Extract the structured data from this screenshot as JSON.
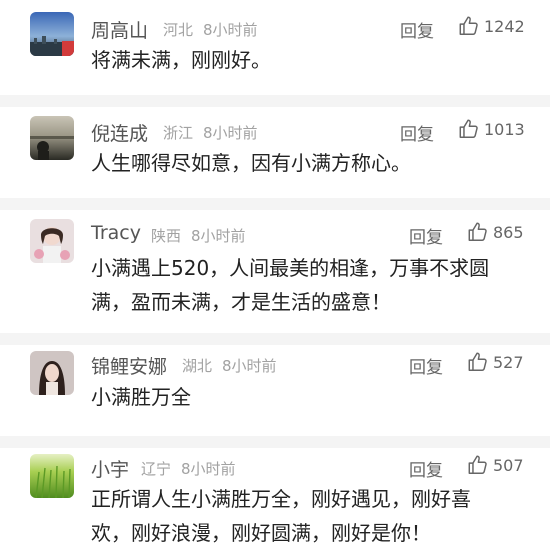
{
  "comments": [
    {
      "username": "周高山",
      "location": "河北",
      "time": "8小时前",
      "reply_label": "回复",
      "likes": "1242",
      "lines": [
        "将满未满，刚刚好。"
      ],
      "avatar": "sky-city-avatar"
    },
    {
      "username": "倪连成",
      "location": "浙江",
      "time": "8小时前",
      "reply_label": "回复",
      "likes": "1013",
      "lines": [
        "人生哪得尽如意，因有小满方称心。"
      ],
      "avatar": "lake-sunset-avatar"
    },
    {
      "username": "Tracy",
      "location": "陕西",
      "time": "8小时前",
      "reply_label": "回复",
      "likes": "865",
      "lines": [
        "小满遇上520，人间最美的相逢，万事不求圆",
        "满，盈而未满，才是生活的盛意！"
      ],
      "avatar": "girl-flowers-avatar"
    },
    {
      "username": "锦鲤安娜",
      "location": "湖北",
      "time": "8小时前",
      "reply_label": "回复",
      "likes": "527",
      "lines": [
        "小满胜万全"
      ],
      "avatar": "girl-portrait-avatar"
    },
    {
      "username": "小宇",
      "location": "辽宁",
      "time": "8小时前",
      "reply_label": "回复",
      "likes": "507",
      "lines": [
        "正所谓人生小满胜万全，刚好遇见，刚好喜",
        "欢，刚好浪漫，刚好圆满，刚好是你！"
      ],
      "avatar": "green-field-avatar"
    }
  ]
}
